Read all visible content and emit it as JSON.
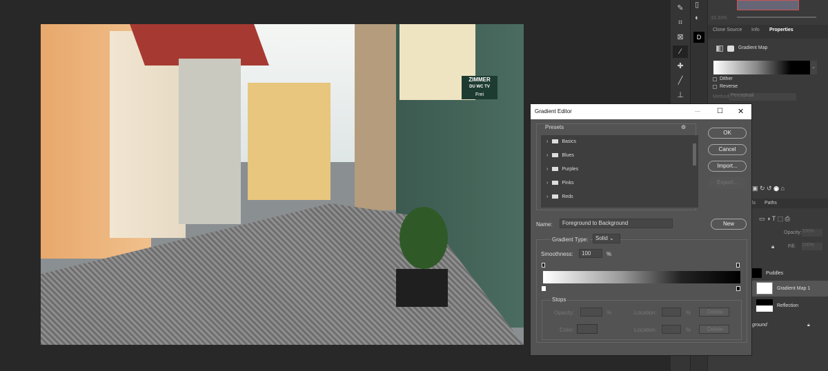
{
  "canvas": {
    "sign_text": "ZIMMER",
    "sign_sub": "DU WC TV",
    "sign_free": "Frei"
  },
  "toolbar": {
    "tools": [
      "brush-tool",
      "crop-tool",
      "frame-tool",
      "eyedropper-tool",
      "healing-tool",
      "brush-tool-2",
      "stamp-tool",
      "history-brush-tool",
      "eraser-tool"
    ]
  },
  "navigator": {
    "zoom": "33.33%"
  },
  "properties": {
    "tabs": [
      "Clone Source",
      "Info",
      "Properties"
    ],
    "active_tab": "Properties",
    "adjustment": "Gradient Map",
    "dither": "Dither",
    "reverse": "Reverse",
    "method_label": "Method:",
    "method_value": "Perceptual"
  },
  "layers": {
    "tabs": [
      "ls",
      "Paths"
    ],
    "opacity_label": "Opacity:",
    "opacity_value": "100%",
    "fill_label": "Fill:",
    "fill_value": "100%",
    "items": [
      {
        "name": "Puddles"
      },
      {
        "name": "Gradient Map 1",
        "selected": true
      },
      {
        "name": "Reflection"
      },
      {
        "name": "ground",
        "locked": true
      }
    ]
  },
  "dialog": {
    "title": "Gradient Editor",
    "presets_label": "Presets",
    "presets": [
      "Basics",
      "Blues",
      "Purples",
      "Pinks",
      "Reds"
    ],
    "ok": "OK",
    "cancel": "Cancel",
    "import": "Import...",
    "export": "Export...",
    "name_label": "Name:",
    "name_value": "Foreground to Background",
    "new": "New",
    "gradient_type_label": "Gradient Type:",
    "gradient_type_value": "Solid",
    "smoothness_label": "Smoothness:",
    "smoothness_value": "100",
    "percent": "%",
    "stops_label": "Stops",
    "opacity_label": "Opacity:",
    "color_label": "Color:",
    "location_label": "Location:",
    "delete": "Delete"
  },
  "colors": {
    "background": "#282828",
    "dialog": "#535353",
    "panel": "#3a3a3a"
  }
}
